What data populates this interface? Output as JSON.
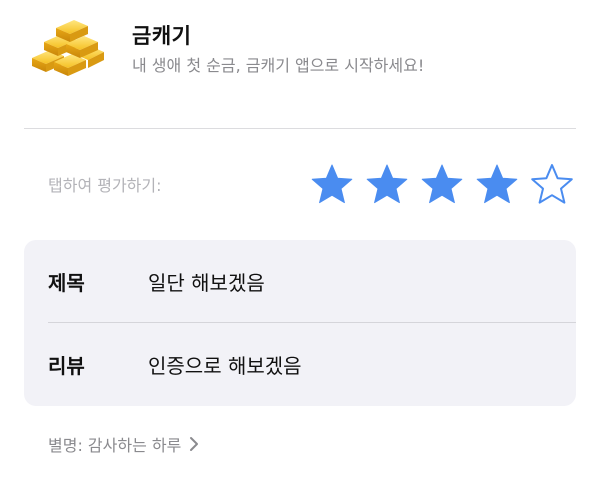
{
  "app": {
    "title": "금캐기",
    "subtitle": "내 생애 첫 순금, 금캐기 앱으로 시작하세요!",
    "icon": "gold-bars-icon"
  },
  "rating": {
    "label": "탭하여 평가하기:",
    "value": 4,
    "max": 5,
    "accent_color": "#4a8cf0"
  },
  "review": {
    "title_label": "제목",
    "title_value": "일단 해보겠음",
    "body_label": "리뷰",
    "body_value": "인증으로 해보겠음"
  },
  "nickname": {
    "text": "별명: 감사하는 하루"
  }
}
